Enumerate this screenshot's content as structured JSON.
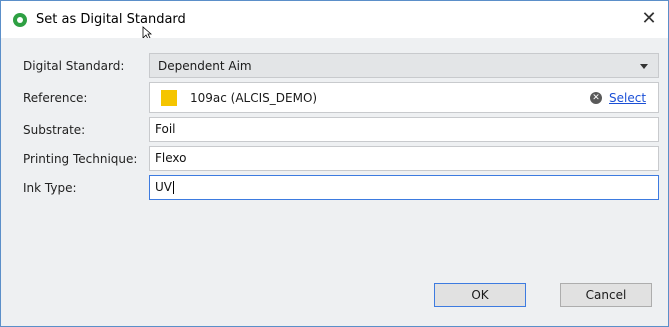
{
  "window": {
    "title": "Set as Digital Standard",
    "close_glyph": "✕"
  },
  "form": {
    "digital_standard": {
      "label": "Digital Standard:",
      "value": "Dependent Aim"
    },
    "reference": {
      "label": "Reference:",
      "value": "109ac (ALCIS_DEMO)",
      "swatch_color": "#f5c500",
      "clear_glyph": "✕",
      "select_label": "Select"
    },
    "substrate": {
      "label": "Substrate:",
      "value": "Foil"
    },
    "printing_technique": {
      "label": "Printing Technique:",
      "value": "Flexo"
    },
    "ink_type": {
      "label": "Ink Type:",
      "value": "UV"
    }
  },
  "buttons": {
    "ok": "OK",
    "cancel": "Cancel"
  }
}
